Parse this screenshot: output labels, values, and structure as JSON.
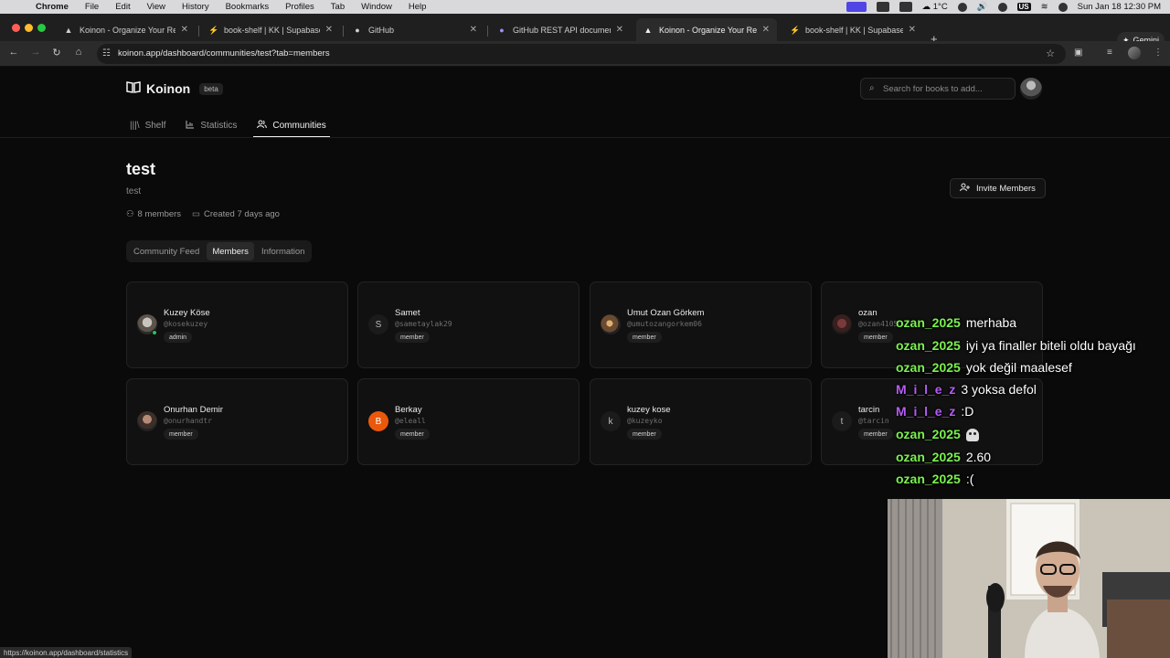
{
  "menubar": {
    "app": "Chrome",
    "items": [
      "File",
      "Edit",
      "View",
      "History",
      "Bookmarks",
      "Profiles",
      "Tab",
      "Window",
      "Help"
    ],
    "weather": "1°C",
    "keyboard": "US",
    "datetime": "Sun Jan 18  12:30 PM"
  },
  "browser": {
    "tabs": [
      {
        "title": "Koinon - Organize Your Readi",
        "icon": "koinon-icon"
      },
      {
        "title": "book-shelf | KK | Supabase",
        "icon": "supabase-icon"
      },
      {
        "title": "GitHub",
        "icon": "github-icon"
      },
      {
        "title": "GitHub REST API documentati",
        "icon": "github-docs-icon"
      },
      {
        "title": "Koinon - Organize Your Readi",
        "icon": "koinon-icon",
        "active": true
      },
      {
        "title": "book-shelf | KK | Supabase",
        "icon": "supabase-icon"
      }
    ],
    "gemini_label": "Gemini",
    "url": "koinon.app/dashboard/communities/test?tab=members",
    "status_link": "https://koinon.app/dashboard/statistics"
  },
  "app": {
    "brand": "Koinon",
    "badge": "beta",
    "search_placeholder": "Search for books to add...",
    "nav": [
      {
        "label": "Shelf",
        "icon": "library-icon"
      },
      {
        "label": "Statistics",
        "icon": "chart-icon"
      },
      {
        "label": "Communities",
        "icon": "users-icon",
        "active": true
      }
    ]
  },
  "community": {
    "name": "test",
    "description": "test",
    "members_count": "8 members",
    "created": "Created 7 days ago",
    "invite_label": "Invite Members",
    "tabs": [
      "Community Feed",
      "Members",
      "Information"
    ],
    "active_tab": "Members",
    "members": [
      {
        "name": "Kuzey Köse",
        "username": "@kosekuzey",
        "role": "admin",
        "avatar": "photo",
        "initial": ""
      },
      {
        "name": "Samet",
        "username": "@sametaylak29",
        "role": "member",
        "avatar": "letter",
        "initial": "S"
      },
      {
        "name": "Umut Ozan Görkem",
        "username": "@umutozangorkem06",
        "role": "member",
        "avatar": "photo2",
        "initial": ""
      },
      {
        "name": "ozan",
        "username": "@ozan4105",
        "role": "member",
        "avatar": "photo3",
        "initial": ""
      },
      {
        "name": "Onurhan Demir",
        "username": "@onurhandtr",
        "role": "member",
        "avatar": "photo4",
        "initial": ""
      },
      {
        "name": "Berkay",
        "username": "@eleall",
        "role": "member",
        "avatar": "orange",
        "initial": "B"
      },
      {
        "name": "kuzey kose",
        "username": "@kuzeyko",
        "role": "member",
        "avatar": "letter",
        "initial": "k"
      },
      {
        "name": "tarcin",
        "username": "@tarcin",
        "role": "member",
        "avatar": "letter",
        "initial": "t"
      }
    ]
  },
  "chat": [
    {
      "user": "ozan_2025",
      "color": "#7cf050",
      "message": "merhaba"
    },
    {
      "user": "ozan_2025",
      "color": "#7cf050",
      "message": "iyi ya finaller biteli oldu bayağı"
    },
    {
      "user": "ozan_2025",
      "color": "#7cf050",
      "message": "yok değil maalesef"
    },
    {
      "user": "M_i_l_e_z",
      "color": "#b45cf5",
      "message": "3 yoksa defol"
    },
    {
      "user": "M_i_l_e_z",
      "color": "#b45cf5",
      "message": ":D"
    },
    {
      "user": "ozan_2025",
      "color": "#7cf050",
      "message": "",
      "icon": "ghost-icon"
    },
    {
      "user": "ozan_2025",
      "color": "#7cf050",
      "message": "2.60"
    },
    {
      "user": "ozan_2025",
      "color": "#7cf050",
      "message": ":("
    }
  ]
}
